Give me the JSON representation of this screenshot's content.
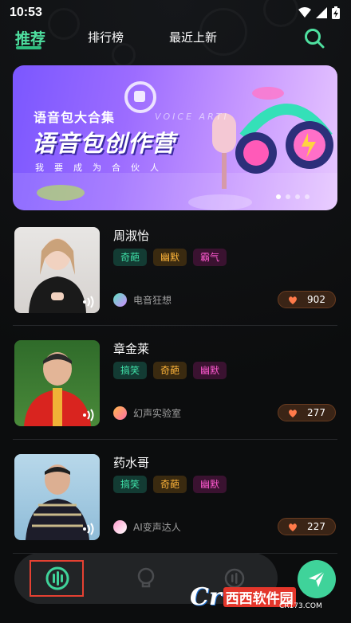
{
  "status_bar": {
    "time": "10:53"
  },
  "nav": {
    "tabs": [
      {
        "label": "推荐",
        "active": true
      },
      {
        "label": "排行榜",
        "active": false
      },
      {
        "label": "最近上新",
        "active": false
      }
    ],
    "search_icon": "search-icon",
    "accent_color": "#4fe0a0"
  },
  "banner": {
    "subtitle": "语音包大合集",
    "title": "语音包创作营",
    "english_text": "VOICE ARTI",
    "slogan": "我要成为合伙人",
    "page_count": 4,
    "active_page": 1
  },
  "voice_packs": [
    {
      "name": "周淑怡",
      "tags": [
        "奇葩",
        "幽默",
        "霸气"
      ],
      "tag_colors": [
        "green",
        "orange",
        "pink"
      ],
      "author": "电音狂想",
      "count": "902"
    },
    {
      "name": "章金莱",
      "tags": [
        "搞笑",
        "奇葩",
        "幽默"
      ],
      "tag_colors": [
        "green",
        "orange",
        "pink"
      ],
      "author": "幻声实验室",
      "count": "277"
    },
    {
      "name": "药水哥",
      "tags": [
        "搞笑",
        "奇葩",
        "幽默"
      ],
      "tag_colors": [
        "green",
        "orange",
        "pink"
      ],
      "author": "AI变声达人",
      "count": "227"
    }
  ],
  "bottom_nav": {
    "items": [
      "voice-icon",
      "lightbulb-icon",
      "mic-icon"
    ],
    "fab_icon": "send-icon"
  },
  "watermark": {
    "logo": "Cr",
    "text": "西西软件园",
    "url": "CR173.COM"
  }
}
